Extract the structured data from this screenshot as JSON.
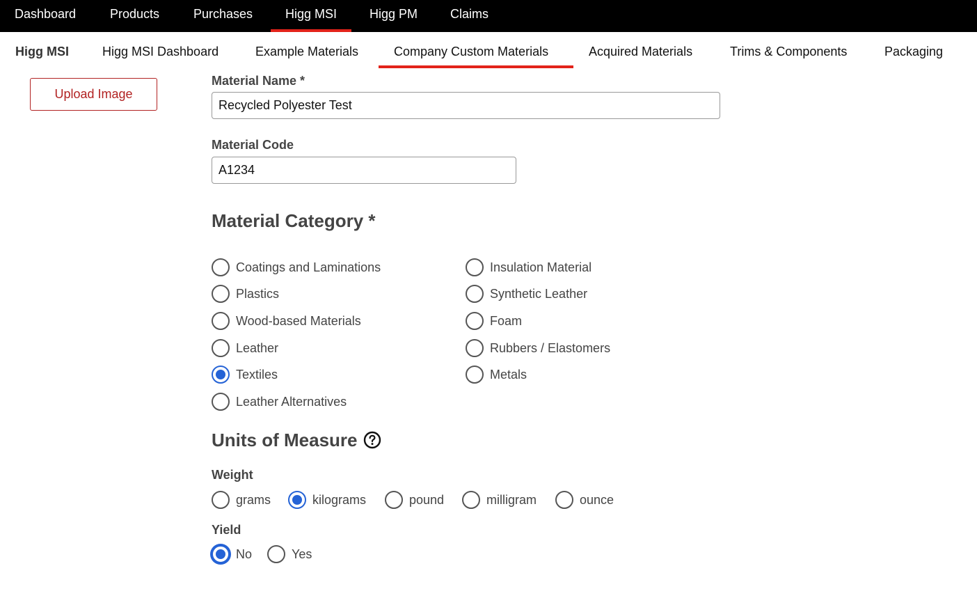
{
  "top_nav": {
    "items": [
      {
        "label": "Dashboard"
      },
      {
        "label": "Products"
      },
      {
        "label": "Purchases"
      },
      {
        "label": "Higg MSI",
        "active": true
      },
      {
        "label": "Higg PM"
      },
      {
        "label": "Claims"
      }
    ]
  },
  "sub_nav": {
    "brand": "Higg MSI",
    "items": [
      {
        "label": "Higg MSI Dashboard"
      },
      {
        "label": "Example Materials"
      },
      {
        "label": "Company Custom Materials",
        "active": true
      },
      {
        "label": "Acquired Materials"
      },
      {
        "label": "Trims & Components"
      },
      {
        "label": "Packaging"
      }
    ]
  },
  "upload_button": "Upload Image",
  "form": {
    "material_name_label": "Material Name *",
    "material_name_value": "Recycled Polyester Test",
    "material_code_label": "Material Code",
    "material_code_value": "A1234",
    "category_heading": "Material Category *",
    "categories": [
      {
        "label": "Coatings and Laminations",
        "checked": false
      },
      {
        "label": "Plastics",
        "checked": false
      },
      {
        "label": "Wood-based Materials",
        "checked": false
      },
      {
        "label": "Leather",
        "checked": false
      },
      {
        "label": "Textiles",
        "checked": true
      },
      {
        "label": "Leather Alternatives",
        "checked": false
      },
      {
        "label": "Insulation Material",
        "checked": false
      },
      {
        "label": "Synthetic Leather",
        "checked": false
      },
      {
        "label": "Foam",
        "checked": false
      },
      {
        "label": "Rubbers / Elastomers",
        "checked": false
      },
      {
        "label": "Metals",
        "checked": false
      }
    ],
    "units_heading": "Units of Measure",
    "help_icon": "question-circle-icon",
    "weight_label": "Weight",
    "weight_options": [
      {
        "label": "grams",
        "checked": false
      },
      {
        "label": "kilograms",
        "checked": true
      },
      {
        "label": "pound",
        "checked": false
      },
      {
        "label": "milligram",
        "checked": false
      },
      {
        "label": "ounce",
        "checked": false
      }
    ],
    "yield_label": "Yield",
    "yield_options": [
      {
        "label": "No",
        "checked": true
      },
      {
        "label": "Yes",
        "checked": false
      }
    ]
  },
  "colors": {
    "accent_red": "#e2231a",
    "radio_blue": "#2563d6"
  }
}
